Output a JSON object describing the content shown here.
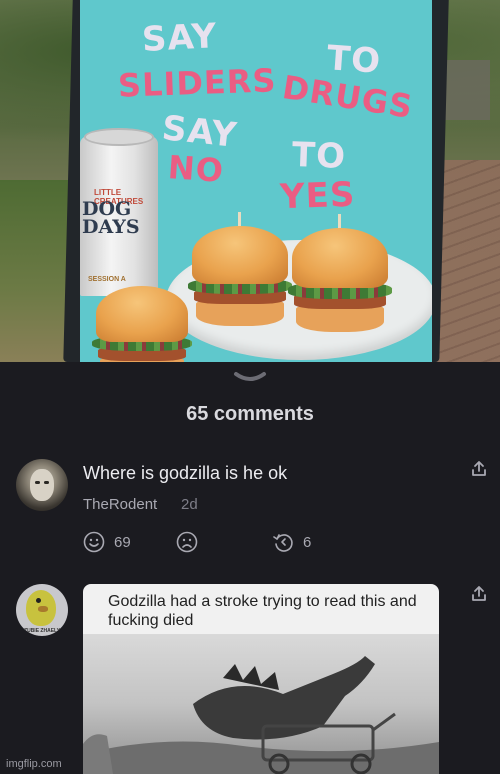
{
  "post_image": {
    "sign_words": {
      "say_1": "SAY",
      "to_1": "TO",
      "sliders": "SLIDERS",
      "drugs": "DRUGS",
      "say_2": "SAY",
      "no": "NO",
      "to_2": "TO",
      "yes": "YES"
    },
    "can": {
      "brand": "LITTLE CREATURES",
      "name": "DOG DAYS",
      "sub": "SESSION A"
    }
  },
  "comments_header": {
    "count_label": "65 comments"
  },
  "comments": [
    {
      "text": "Where is godzilla is he ok",
      "author": "TheRodent",
      "age": "2d",
      "likes": "69",
      "replies": "6"
    },
    {
      "meme_caption": "Godzilla had a stroke trying to read this and fucking died",
      "avatar_tag": "ZUBIE ZHAELY"
    }
  ],
  "watermark": "imgflip.com",
  "colors": {
    "background": "#1b1b20",
    "sign": "#5fc8cc",
    "sign_pink": "#ea5d83",
    "text_primary": "#ececf0",
    "text_secondary": "#a9a9b2"
  },
  "icons": [
    "chevron-down-icon",
    "smile-icon",
    "frown-icon",
    "reply-icon",
    "share-icon"
  ]
}
